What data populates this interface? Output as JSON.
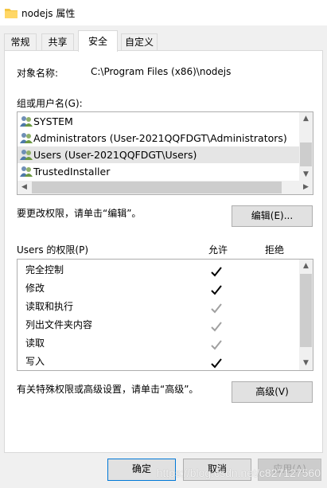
{
  "window": {
    "title": "nodejs 属性"
  },
  "tabs": [
    {
      "label": "常规"
    },
    {
      "label": "共享"
    },
    {
      "label": "安全"
    },
    {
      "label": "自定义"
    }
  ],
  "security": {
    "object_name_label": "对象名称:",
    "object_name_value": "C:\\Program Files (x86)\\nodejs",
    "groups_label": "组或用户名(G):",
    "groups": [
      {
        "name": "SYSTEM",
        "selected": false
      },
      {
        "name": "Administrators (User-2021QQFDGT\\Administrators)",
        "selected": false
      },
      {
        "name": "Users (User-2021QQFDGT\\Users)",
        "selected": true
      },
      {
        "name": "TrustedInstaller",
        "selected": false
      }
    ],
    "edit_hint": "要更改权限，请单击“编辑”。",
    "edit_button": "编辑(E)...",
    "perm_title": "Users 的权限(P)",
    "allow_header": "允许",
    "deny_header": "拒绝",
    "permissions": [
      {
        "name": "完全控制",
        "allow": "explicit"
      },
      {
        "name": "修改",
        "allow": "explicit"
      },
      {
        "name": "读取和执行",
        "allow": "inherited"
      },
      {
        "name": "列出文件夹内容",
        "allow": "inherited"
      },
      {
        "name": "读取",
        "allow": "inherited"
      },
      {
        "name": "写入",
        "allow": "explicit"
      }
    ],
    "advanced_hint": "有关特殊权限或高级设置，请单击“高级”。",
    "advanced_button": "高级(V)"
  },
  "footer": {
    "ok": "确定",
    "cancel": "取消",
    "apply": "应用(A)"
  },
  "watermark": "https://blog.csdn.net/c827127560",
  "colors": {
    "check_explicit": "#000000",
    "check_inherited": "#a0a0a0",
    "folder_icon": "#f4c542"
  }
}
